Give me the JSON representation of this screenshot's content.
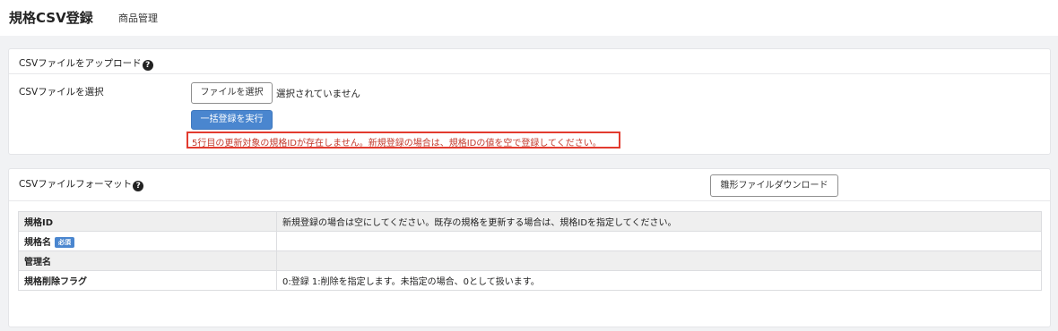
{
  "header": {
    "title": "規格CSV登録",
    "subtitle": "商品管理"
  },
  "upload": {
    "title": "CSVファイルをアップロード",
    "help_icon": "?",
    "field_label": "CSVファイルを選択",
    "file_button_label": "ファイルを選択",
    "file_status": "選択されていません",
    "submit_label": "一括登録を実行",
    "error_message": "5行目の更新対象の規格IDが存在しません。新規登録の場合は、規格IDの値を空で登録してください。"
  },
  "format": {
    "title": "CSVファイルフォーマット",
    "help_icon": "?",
    "download_label": "雛形ファイルダウンロード",
    "required_badge": "必須",
    "rows": [
      {
        "name": "規格ID",
        "description": "新規登録の場合は空にしてください。既存の規格を更新する場合は、規格IDを指定してください。"
      },
      {
        "name": "規格名",
        "description": ""
      },
      {
        "name": "管理名",
        "description": ""
      },
      {
        "name": "規格削除フラグ",
        "description": "0:登録 1:削除を指定します。未指定の場合、0として扱います。"
      }
    ]
  },
  "colors": {
    "accent": "#4a86cf",
    "error": "#c3392b",
    "error_border": "#e23b2f"
  }
}
